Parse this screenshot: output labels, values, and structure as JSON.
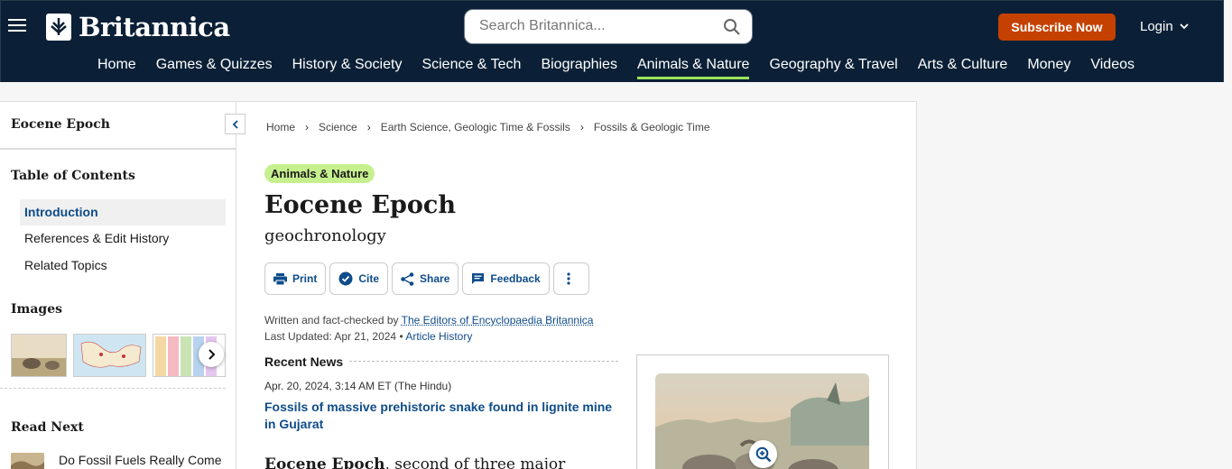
{
  "header": {
    "logo_text": "Britannica",
    "search_placeholder": "Search Britannica...",
    "subscribe_label": "Subscribe Now",
    "login_label": "Login",
    "nav": [
      "Home",
      "Games & Quizzes",
      "History & Society",
      "Science & Tech",
      "Biographies",
      "Animals & Nature",
      "Geography & Travel",
      "Arts & Culture",
      "Money",
      "Videos"
    ],
    "active_nav": "Animals & Nature",
    "colors": {
      "background": "#0b2036",
      "subscribe": "#c54101",
      "active_underline": "#9ce45a"
    }
  },
  "sidebar": {
    "title": "Eocene Epoch",
    "toc_heading": "Table of Contents",
    "toc": [
      "Introduction",
      "References & Edit History",
      "Related Topics"
    ],
    "active_toc": "Introduction",
    "images_heading": "Images",
    "read_next_heading": "Read Next",
    "read_next_item": "Do Fossil Fuels Really Come from Fossils?"
  },
  "breadcrumbs": [
    "Home",
    "Science",
    "Earth Science, Geologic Time & Fossils",
    "Fossils & Geologic Time"
  ],
  "article": {
    "topic_badge": "Animals & Nature",
    "title": "Eocene Epoch",
    "subtitle": "geochronology",
    "toolbar": {
      "print": "Print",
      "cite": "Cite",
      "share": "Share",
      "feedback": "Feedback"
    },
    "byline_prefix": "Written and fact-checked by",
    "byline_author": "The Editors of Encyclopaedia Britannica",
    "updated_prefix": "Last Updated: Apr 21, 2024 •",
    "article_history": "Article History",
    "recent_news_heading": "Recent News",
    "news_date": "Apr. 20, 2024, 3:14 AM ET (The Hindu)",
    "news_headline": "Fossils of massive prehistoric snake found in lignite mine in Gujarat",
    "intro_bold": "Eocene Epoch",
    "intro_rest": ", second of three major"
  }
}
